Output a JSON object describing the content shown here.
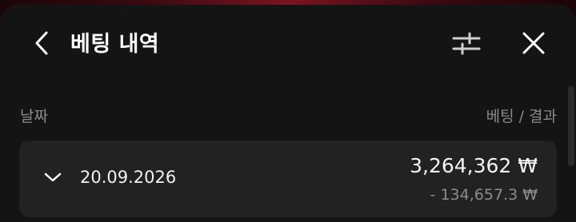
{
  "header": {
    "title": "베팅 내역",
    "back_icon": "chevron-left-icon",
    "filter_icon": "filter-sliders-icon",
    "close_icon": "close-icon"
  },
  "columns": {
    "date_label": "날짜",
    "bet_result_label": "베팅 / 결과"
  },
  "rows": [
    {
      "date": "20.09.2026",
      "amount": "3,264,362 ₩",
      "result": "- 134,657.3 ₩",
      "expand_icon": "chevron-down-icon"
    }
  ],
  "colors": {
    "panel_bg": "#141414",
    "row_bg": "#222222",
    "text_primary": "#ffffff",
    "text_secondary": "#8a8a8a"
  }
}
